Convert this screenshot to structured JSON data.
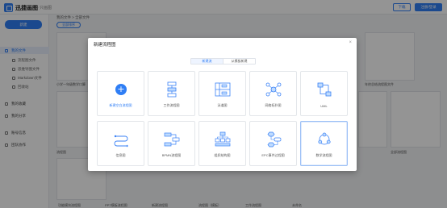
{
  "app": {
    "title": "迅捷画图",
    "subtitle": "- 只画图"
  },
  "topbar": {
    "download_label": "下载",
    "user_label": "注册/登录"
  },
  "sidebar": {
    "new_label": "新建",
    "items": [
      {
        "label": "我的文件"
      },
      {
        "label": "流程图文件"
      },
      {
        "label": "思维导图文件"
      },
      {
        "label": "Markdown文件"
      },
      {
        "label": "回收站"
      },
      {
        "label": "我的收藏"
      },
      {
        "label": "我的分享"
      },
      {
        "label": "账号信息"
      },
      {
        "label": "团队协作"
      }
    ]
  },
  "main": {
    "breadcrumb": "我的文件 > 全部文件",
    "sort_label": "全部排序",
    "files": [
      "小学一年级数学口算",
      "表格题",
      "年终总结流程图文件",
      "PRT鱼骨图模板",
      "流程图",
      "计划书",
      "我的模板",
      "组织流程图",
      "全部流程图",
      "功能模块流程图",
      "PPT模板流程图",
      "新建流程图",
      "流程图（模板）",
      "工作流程图",
      "未命名"
    ]
  },
  "modal": {
    "title": "新建流程图",
    "close_label": "×",
    "tabs": [
      "新建流",
      "从模板新建"
    ],
    "tiles": [
      {
        "label": "新建空白流程图",
        "icon": "plus-icon"
      },
      {
        "label": "工作流程图",
        "icon": "workflow-icon"
      },
      {
        "label": "泳道图",
        "icon": "swimlane-icon"
      },
      {
        "label": "网络拓扑图",
        "icon": "network-topology-icon"
      },
      {
        "label": "UML",
        "icon": "uml-icon"
      },
      {
        "label": "信息图",
        "icon": "info-graph-icon"
      },
      {
        "label": "BPMN流程图",
        "icon": "bpmn-icon"
      },
      {
        "label": "组织结构图",
        "icon": "org-chart-icon"
      },
      {
        "label": "EPC事件过程图",
        "icon": "epc-icon"
      },
      {
        "label": "数学流程图",
        "icon": "cycle-icon"
      }
    ]
  },
  "colors": {
    "accent": "#2f7ef5",
    "overlay": "rgba(0,0,0,0.42)"
  }
}
